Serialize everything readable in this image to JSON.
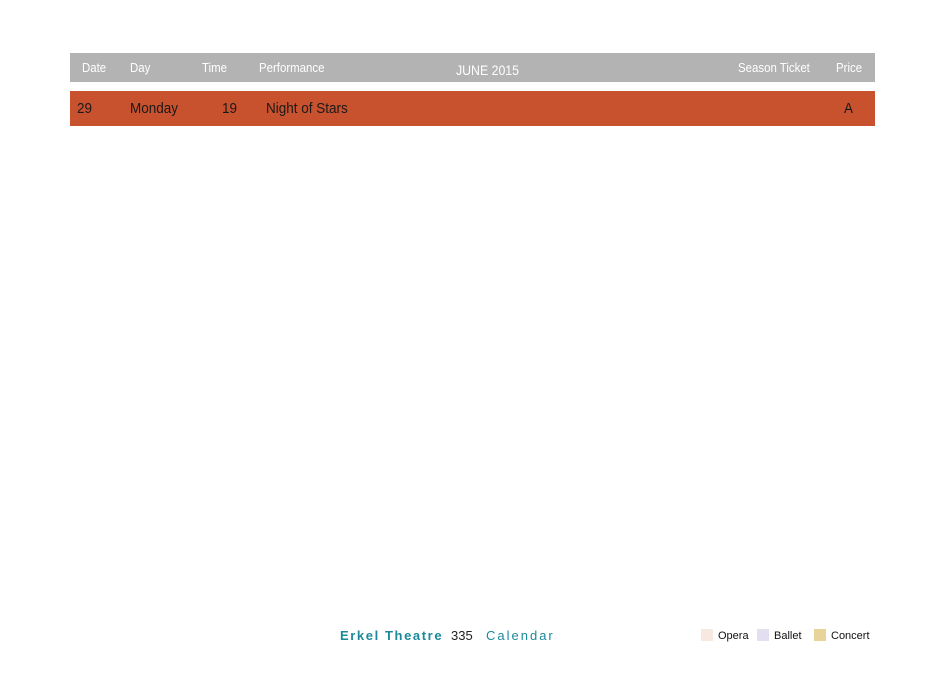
{
  "header": {
    "date": "Date",
    "day": "Day",
    "time": "Time",
    "performance": "Performance",
    "month": "JUNE 2015",
    "season_ticket": "Season Ticket",
    "price": "Price"
  },
  "rows": [
    {
      "date": "29",
      "day": "Monday",
      "time": "19",
      "performance": "Night of Stars",
      "season_ticket": "",
      "price": "A"
    }
  ],
  "footer": {
    "theatre": "Erkel Theatre",
    "page": "335",
    "section": "Calendar"
  },
  "legend": [
    {
      "label": "Opera",
      "color": "#f7e9e0"
    },
    {
      "label": "Ballet",
      "color": "#e3dff0"
    },
    {
      "label": "Concert",
      "color": "#e8d49a"
    }
  ],
  "colors": {
    "header_bg": "#b3b3b3",
    "row_concert": "#c8512e",
    "accent": "#1a8a9a"
  }
}
